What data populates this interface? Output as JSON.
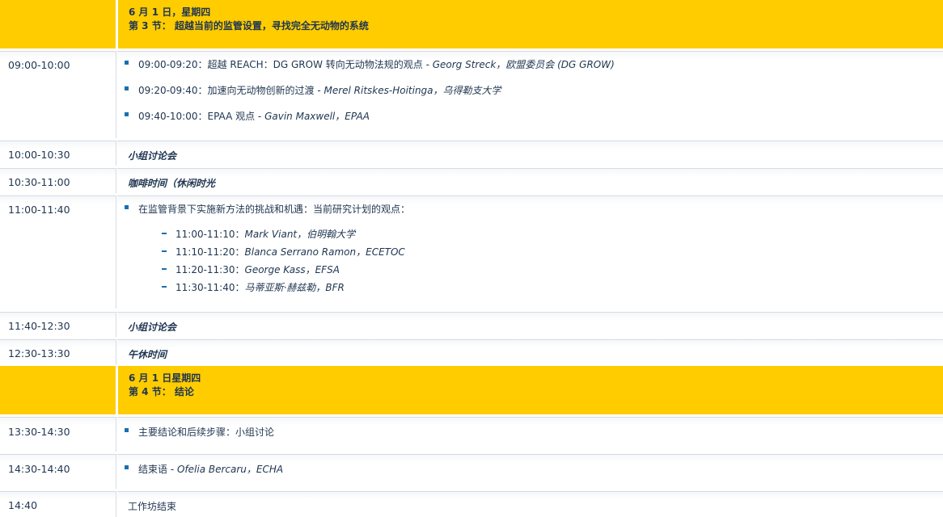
{
  "session3": {
    "header_date": "6 月 1 日，星期四",
    "header_title": "第 3 节： 超越当前的监管设置，寻找完全无动物的系统"
  },
  "rows": {
    "r1": {
      "time": "09:00-10:00",
      "items": [
        {
          "time": "09:00-09:20",
          "text": "：超越 REACH：DG GROW 转向无动物法规的观点 - ",
          "speaker": "Georg Streck，欧盟委员会 (DG GROW)"
        },
        {
          "time": "09:20-09:40",
          "text": "：加速向无动物创新的过渡 - ",
          "speaker": "Merel Ritskes-Hoitinga，乌得勒支大学"
        },
        {
          "time": "09:40-10:00",
          "text": "：EPAA 观点 - ",
          "speaker": "Gavin Maxwell，EPAA"
        }
      ]
    },
    "r2": {
      "time": "10:00-10:30",
      "text": "小组讨论会"
    },
    "r3": {
      "time": "10:30-11:00",
      "text": "咖啡时间（休闲时光"
    },
    "r4": {
      "time": "11:00-11:40",
      "intro": "在监管背景下实施新方法的挑战和机遇：当前研究计划的观点：",
      "subitems": [
        {
          "time": "11:00-11:10",
          "speaker": "Mark Viant，伯明翰大学"
        },
        {
          "time": "11:10-11:20",
          "speaker": "Blanca Serrano Ramon，ECETOC"
        },
        {
          "time": "11:20-11:30",
          "speaker": "George Kass，EFSA"
        },
        {
          "time": "11:30-11:40",
          "speaker": "马蒂亚斯·赫兹勒，BFR"
        }
      ]
    },
    "r5": {
      "time": "11:40-12:30",
      "text": "小组讨论会"
    },
    "r6": {
      "time": "12:30-13:30",
      "text": "午休时间"
    },
    "r7": {
      "time": "13:30-14:30",
      "text": "主要结论和后续步骤：小组讨论"
    },
    "r8": {
      "time": "14:30-14:40",
      "text": "结束语 - ",
      "speaker": "Ofelia Bercaru，ECHA"
    },
    "r9": {
      "time": "14:40",
      "text": "工作坊结束"
    }
  },
  "session4": {
    "header_date": "6 月 1 日星期四",
    "header_title": "第 4 节： 结论"
  },
  "colors": {
    "header_bg": "#ffcc00",
    "text": "#1f3550",
    "bullet": "#1a6fb0",
    "border": "#d6dbe0"
  }
}
